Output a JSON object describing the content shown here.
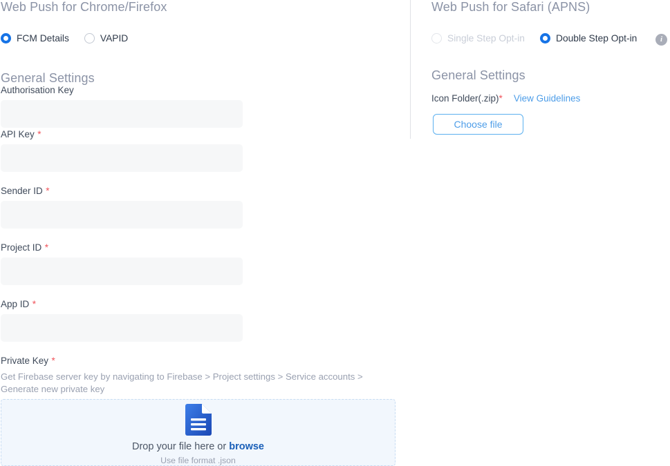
{
  "left_panel": {
    "title": "Web Push for Chrome/Firefox",
    "radio_group": {
      "options": [
        {
          "label": "FCM Details",
          "selected": true,
          "disabled": false
        },
        {
          "label": "VAPID",
          "selected": false,
          "disabled": false
        }
      ]
    },
    "general_settings_heading": "General Settings",
    "fields": [
      {
        "label": "Authorisation Key",
        "required": false,
        "value": "",
        "placeholder": ""
      },
      {
        "label": "API Key",
        "required": true,
        "value": "",
        "placeholder": ""
      },
      {
        "label": "Sender ID",
        "required": true,
        "value": "",
        "placeholder": ""
      },
      {
        "label": "Project ID",
        "required": true,
        "value": "",
        "placeholder": ""
      },
      {
        "label": "App ID",
        "required": true,
        "value": "",
        "placeholder": ""
      }
    ],
    "private_key": {
      "label": "Private Key",
      "required": true,
      "helper": "Get Firebase server key by navigating to Firebase > Project settings > Service accounts > Generate new private key"
    },
    "dropzone": {
      "main_text": "Drop your file here or ",
      "browse_text": "browse",
      "sub_text": "Use file format .json",
      "icon": "document-icon"
    }
  },
  "right_panel": {
    "title": "Web Push for Safari (APNS)",
    "radio_group": {
      "options": [
        {
          "label": "Single Step Opt-in",
          "selected": false,
          "disabled": true
        },
        {
          "label": "Double Step Opt-in",
          "selected": true,
          "disabled": false
        }
      ]
    },
    "info_icon_glyph": "i",
    "general_settings_heading": "General Settings",
    "icon_folder": {
      "label": "Icon Folder(.zip)",
      "required": true,
      "guidelines_link": "View Guidelines",
      "choose_file_label": "Choose file"
    }
  },
  "colors": {
    "accent_blue": "#1673e6",
    "link_blue": "#4d9de8",
    "required_red": "#f0545b",
    "heading_grey": "#8b93a6",
    "input_bg": "#f6f7f8",
    "dropzone_bg": "#f2f7fd",
    "dropzone_border": "#c7dcf3",
    "divider": "#dfe1e6"
  }
}
